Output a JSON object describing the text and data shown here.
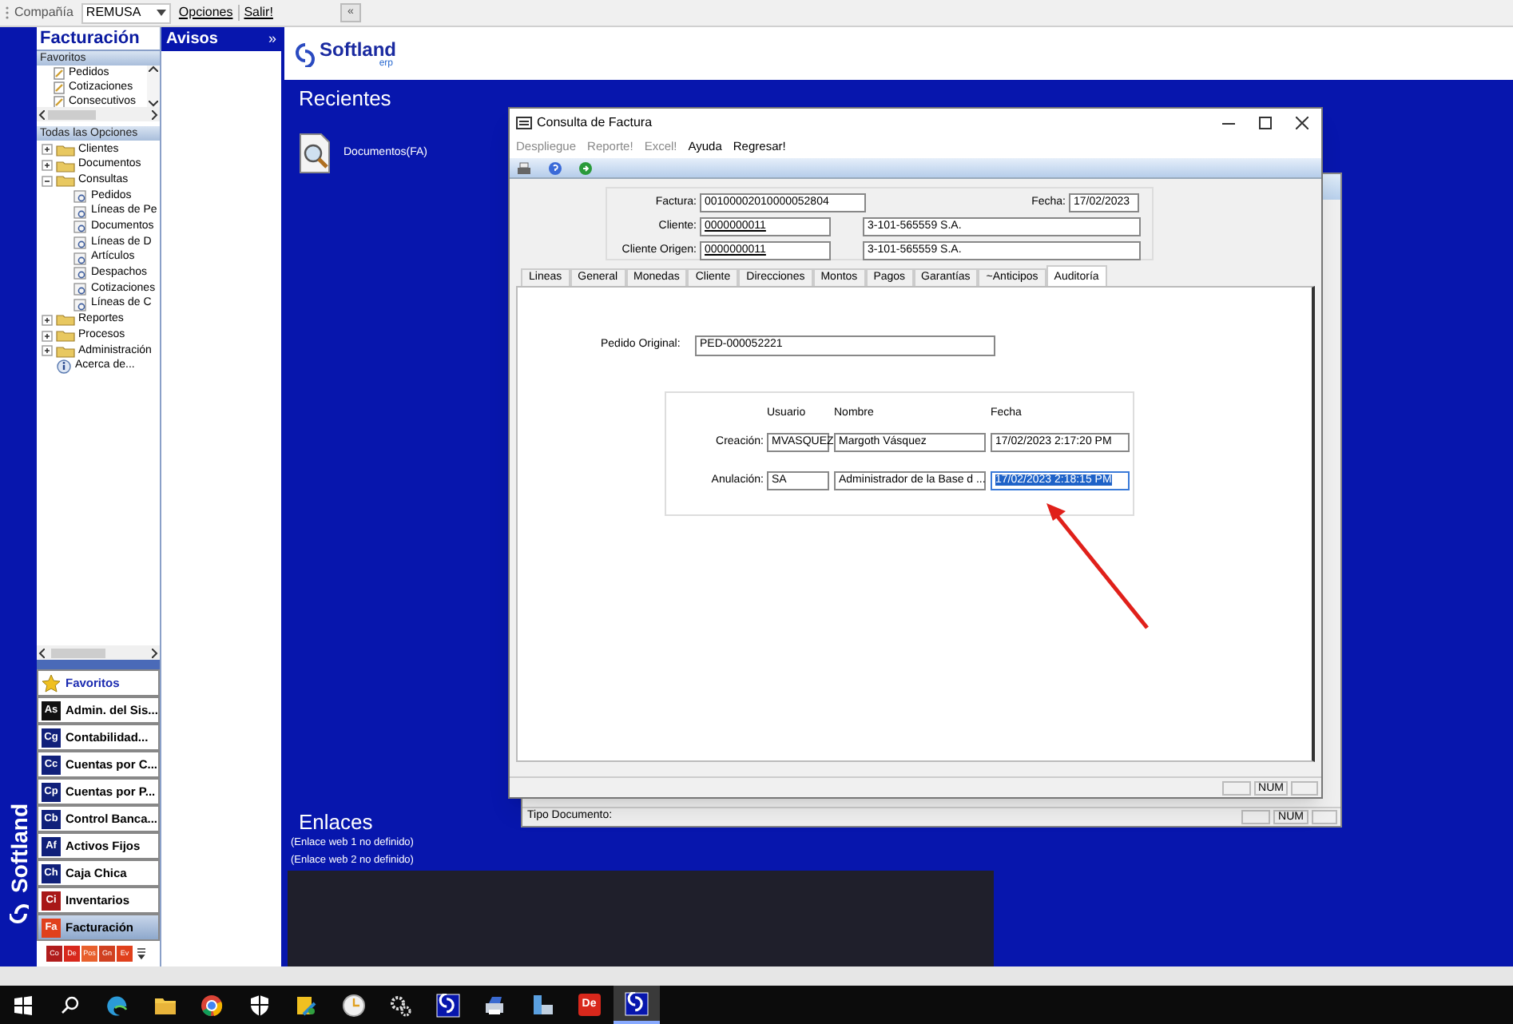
{
  "toolbar": {
    "company_label": "Compañía",
    "company": "REMUSA",
    "menu": [
      "Opciones",
      "Salir!"
    ],
    "collapse": "«"
  },
  "brand": {
    "side": "Softland",
    "header": "Softland",
    "header_sub": "erp"
  },
  "sidebar": {
    "title": "Facturación",
    "favorites_header": "Favoritos",
    "favorites": [
      "Pedidos",
      "Cotizaciones",
      "Consecutivos"
    ],
    "all_header": "Todas las Opciones",
    "tree": [
      {
        "label": "Clientes",
        "expanded": false
      },
      {
        "label": "Documentos",
        "expanded": false
      },
      {
        "label": "Consultas",
        "expanded": true,
        "children": [
          {
            "label": "Pedidos"
          },
          {
            "label": "Líneas de Pe"
          },
          {
            "label": "Documentos"
          },
          {
            "label": "Líneas de D"
          },
          {
            "label": "Artículos"
          },
          {
            "label": "Despachos"
          },
          {
            "label": "Cotizaciones"
          },
          {
            "label": "Líneas de C"
          }
        ]
      },
      {
        "label": "Reportes",
        "expanded": false
      },
      {
        "label": "Procesos",
        "expanded": false
      },
      {
        "label": "Administración",
        "expanded": false
      },
      {
        "label": "Acerca de...",
        "kind": "info"
      }
    ],
    "modules": [
      {
        "label": "Favoritos",
        "kind": "star",
        "selected": false
      },
      {
        "label": "Admin. del Sis...",
        "badge": "As",
        "color": "#111111",
        "selected": false
      },
      {
        "label": "Contabilidad...",
        "badge": "Cg",
        "color": "#10207a",
        "selected": false
      },
      {
        "label": "Cuentas por C...",
        "badge": "Cc",
        "color": "#10207a",
        "selected": false
      },
      {
        "label": "Cuentas por P...",
        "badge": "Cp",
        "color": "#10207a",
        "selected": false
      },
      {
        "label": "Control Banca...",
        "badge": "Cb",
        "color": "#10207a",
        "selected": false
      },
      {
        "label": "Activos Fijos",
        "badge": "Af",
        "color": "#10207a",
        "selected": false
      },
      {
        "label": "Caja Chica",
        "badge": "Ch",
        "color": "#10207a",
        "selected": false
      },
      {
        "label": "Inventarios",
        "badge": "Ci",
        "color": "#a81818",
        "selected": false
      },
      {
        "label": "Facturación",
        "badge": "Fa",
        "color": "#e0401c",
        "selected": true
      }
    ],
    "mini_modules": [
      {
        "badge": "Co",
        "color": "#b01c1c"
      },
      {
        "badge": "De",
        "color": "#d8281c"
      },
      {
        "badge": "Pos",
        "color": "#e8602c"
      },
      {
        "badge": "Gn",
        "color": "#d04020"
      },
      {
        "badge": "Ev",
        "color": "#e0401c"
      }
    ]
  },
  "avisos": {
    "title": "Avisos",
    "expand": "»"
  },
  "main": {
    "recent_title": "Recientes",
    "recent": [
      {
        "label": "Documentos(FA)"
      }
    ],
    "links_title": "Enlaces",
    "links": [
      "(Enlace web 1 no definido)",
      "(Enlace web 2 no definido)"
    ]
  },
  "back_window": {
    "status_label": "Tipo Documento:",
    "indicator": "NUM"
  },
  "dialog": {
    "title": "Consulta de Factura",
    "menu": [
      {
        "label": "Despliegue",
        "disabled": true
      },
      {
        "label": "Reporte!",
        "disabled": true
      },
      {
        "label": "Excel!",
        "disabled": true
      },
      {
        "label": "Ayuda",
        "disabled": false
      },
      {
        "label": "Regresar!",
        "disabled": false
      }
    ],
    "factura_label": "Factura:",
    "factura": "00100002010000052804",
    "fecha_label": "Fecha:",
    "fecha": "17/02/2023",
    "cliente_label": "Cliente:",
    "cliente": "0000000011",
    "cliente_name": "3-101-565559 S.A.",
    "origen_label": "Cliente Origen:",
    "origen": "0000000011",
    "origen_name": "3-101-565559 S.A.",
    "tabs": [
      {
        "label": "Lineas",
        "selected": false
      },
      {
        "label": "General",
        "selected": false
      },
      {
        "label": "Monedas",
        "selected": false
      },
      {
        "label": "Cliente",
        "selected": false
      },
      {
        "label": "Direcciones",
        "selected": false
      },
      {
        "label": "Montos",
        "selected": false
      },
      {
        "label": "Pagos",
        "selected": false
      },
      {
        "label": "Garantías",
        "selected": false
      },
      {
        "label": "~Anticipos",
        "selected": false
      },
      {
        "label": "Auditoría",
        "selected": true
      }
    ],
    "pedido_label": "Pedido Original:",
    "pedido": "PED-000052221",
    "audit_columns": [
      "Usuario",
      "Nombre",
      "Fecha"
    ],
    "audit_rows": [
      {
        "label": "Creación:",
        "usuario": "MVASQUEZ",
        "nombre": "Margoth Vásquez",
        "fecha": "17/02/2023 2:17:20 PM",
        "fecha_highlighted": false
      },
      {
        "label": "Anulación:",
        "usuario": "SA",
        "nombre": "Administrador de la Base d ...",
        "fecha": "17/02/2023 2:18:15 PM",
        "fecha_highlighted": true
      }
    ],
    "indicator": "NUM"
  },
  "taskbar": [
    {
      "kind": "windows",
      "selected": false
    },
    {
      "kind": "search",
      "selected": false
    },
    {
      "kind": "edge",
      "selected": false
    },
    {
      "kind": "folder",
      "selected": false
    },
    {
      "kind": "chrome",
      "selected": false
    },
    {
      "kind": "shield",
      "selected": false
    },
    {
      "kind": "tool",
      "selected": false
    },
    {
      "kind": "clock",
      "selected": false
    },
    {
      "kind": "gear",
      "selected": false
    },
    {
      "kind": "softland",
      "selected": false
    },
    {
      "kind": "printer",
      "selected": false
    },
    {
      "kind": "building",
      "selected": false
    },
    {
      "kind": "badge",
      "label": "De",
      "selected": false
    },
    {
      "kind": "softland",
      "selected": true
    }
  ]
}
